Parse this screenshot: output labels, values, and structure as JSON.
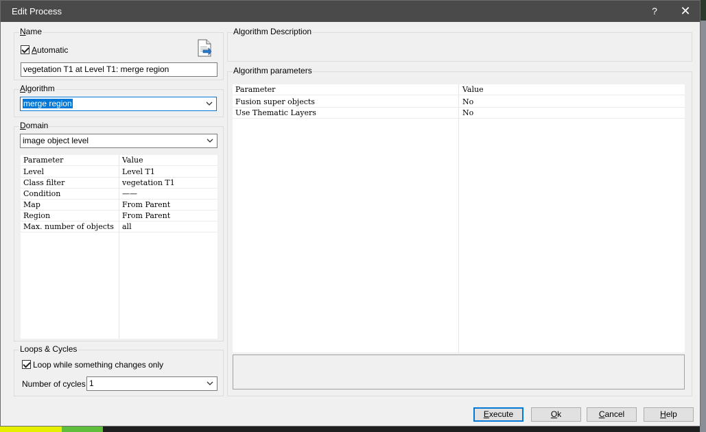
{
  "window": {
    "title": "Edit Process",
    "help_glyph": "?",
    "close_glyph": "✕"
  },
  "name_group": {
    "label_first": "N",
    "label_rest": "ame",
    "automatic_first": "A",
    "automatic_rest": "utomatic",
    "automatic_checked": true,
    "value": "vegetation T1 at  Level T1: merge region"
  },
  "algorithm_group": {
    "label_first": "A",
    "label_rest": "lgorithm",
    "selected": "merge region"
  },
  "domain_group": {
    "label_first": "D",
    "label_rest": "omain",
    "selected": "image object level",
    "table": {
      "headers": [
        "Parameter",
        "Value"
      ],
      "rows": [
        [
          "Level",
          "Level T1"
        ],
        [
          "Class filter",
          "vegetation T1"
        ],
        [
          "Condition",
          "——"
        ],
        [
          "Map",
          "From Parent"
        ],
        [
          "Region",
          "From Parent"
        ],
        [
          "Max. number of objects",
          "all"
        ]
      ]
    }
  },
  "loops_group": {
    "label": "Loops & Cycles",
    "loop_checkbox_label": "Loop while something changes only",
    "loop_checked": true,
    "cycles_label": "Number of cycles",
    "cycles_value": "1"
  },
  "algorithm_description": {
    "label": "Algorithm Description"
  },
  "algorithm_parameters": {
    "label": "Algorithm parameters",
    "table": {
      "headers": [
        "Parameter",
        "Value"
      ],
      "rows": [
        [
          "Fusion super objects",
          "No"
        ],
        [
          "Use Thematic Layers",
          "No"
        ]
      ]
    }
  },
  "buttons": {
    "execute_first": "E",
    "execute_rest": "xecute",
    "ok_first": "O",
    "ok_rest": "k",
    "cancel_first": "C",
    "cancel_rest": "ancel",
    "help_first": "H",
    "help_rest": "elp"
  },
  "icons": {
    "dropdown": "chevron-down-icon",
    "document": "document-icon",
    "checkmark": "checkmark-icon"
  },
  "colors": {
    "titlebar": "#4a4a4a",
    "accent": "#0078d7",
    "dialog_bg": "#f0f0f0"
  }
}
